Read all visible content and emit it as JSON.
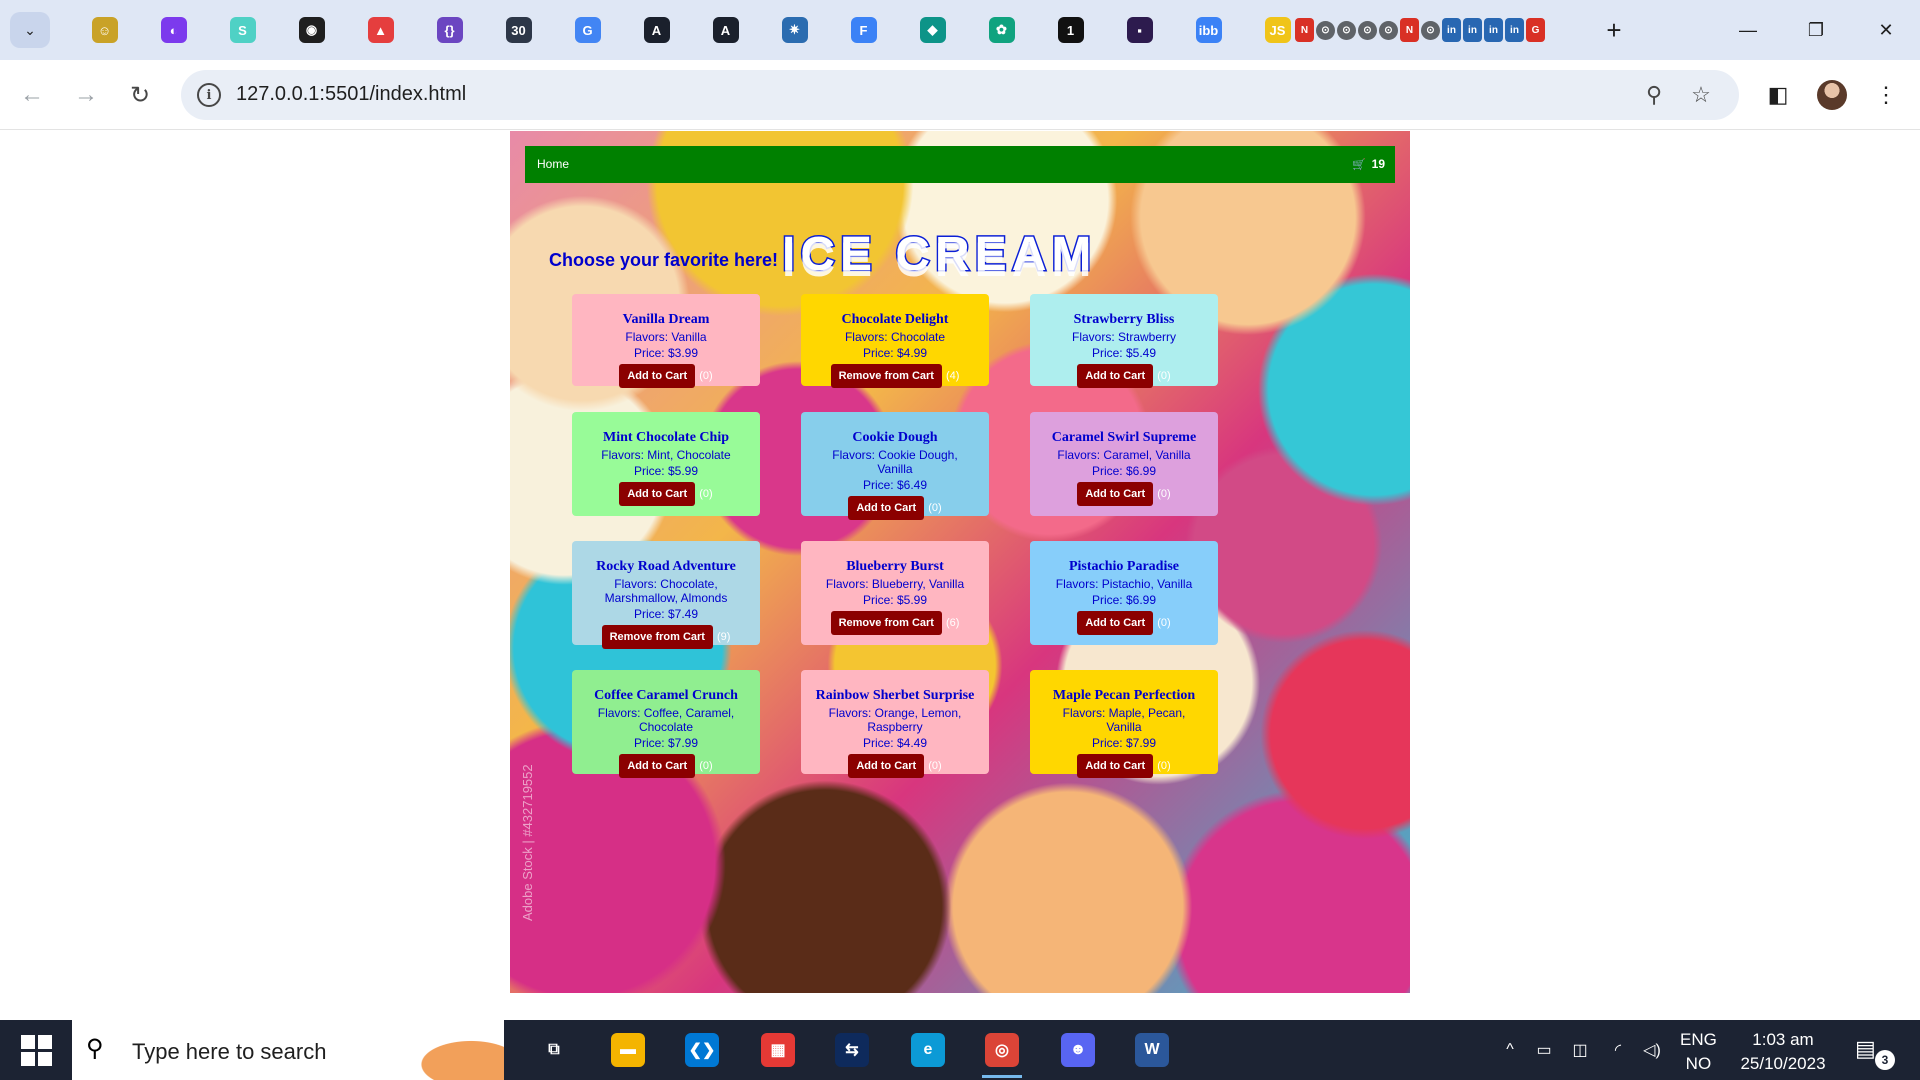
{
  "browser": {
    "tab_icons": [
      {
        "name": "chatbot-tab-icon",
        "glyph": "☺",
        "color": "#c9a227"
      },
      {
        "name": "arc-tab-icon",
        "glyph": "◐",
        "color": "#7c3aed"
      },
      {
        "name": "s-tab-icon",
        "glyph": "S",
        "color": "#4fd1c5"
      },
      {
        "name": "github-tab-icon",
        "glyph": "◉",
        "color": "#1f1f1f"
      },
      {
        "name": "warning-tab-icon",
        "glyph": "▲",
        "color": "#e53e3e"
      },
      {
        "name": "code-tab-icon",
        "glyph": "{}",
        "color": "#6b46c1"
      },
      {
        "name": "thirty-tab-icon",
        "glyph": "30",
        "color": "#2d3748"
      },
      {
        "name": "google-tab-icon",
        "glyph": "G",
        "color": "#4285f4"
      },
      {
        "name": "regex-tab-icon",
        "glyph": "A",
        "color": "#1a202c"
      },
      {
        "name": "regex2-tab-icon",
        "glyph": "A",
        "color": "#1a202c"
      },
      {
        "name": "fan-tab-icon",
        "glyph": "✷",
        "color": "#2b6cb0"
      },
      {
        "name": "forms-tab-icon",
        "glyph": "F",
        "color": "#3b82f6"
      },
      {
        "name": "diamond-tab-icon",
        "glyph": "◆",
        "color": "#0d9488"
      },
      {
        "name": "openai-tab-icon",
        "glyph": "✿",
        "color": "#10a37f"
      },
      {
        "name": "one-tab-icon",
        "glyph": "1",
        "color": "#111111"
      },
      {
        "name": "terminal-tab-icon",
        "glyph": "▪",
        "color": "#2d1b4e"
      },
      {
        "name": "ibb-tab-icon",
        "glyph": "ibb",
        "color": "#3b82f6"
      },
      {
        "name": "js-tab-icon",
        "glyph": "JS",
        "color": "#f0c419"
      }
    ],
    "tab_cluster": [
      "N",
      "⊙",
      "⊙",
      "⊙",
      "⊙",
      "N",
      "⊙",
      "in",
      "in",
      "in",
      "in",
      "G"
    ],
    "new_tab": "+",
    "window": {
      "minimize": "—",
      "restore": "❐",
      "close": "✕"
    },
    "nav": {
      "back": "←",
      "forward": "→",
      "reload": "↻"
    },
    "url": "127.0.0.1:5501/index.html",
    "omni_actions": {
      "zoom": "⚲",
      "bookmark": "☆"
    },
    "sidebar_toggle": "◧",
    "menu": "⋮"
  },
  "site": {
    "nav_home": "Home",
    "cart_count": "19",
    "tagline": "Choose your favorite here!",
    "brand": "ICE CREAM",
    "watermark": "Adobe Stock | #432719552"
  },
  "products": [
    {
      "name": "Vanilla Dream",
      "flavors": "Flavors: Vanilla",
      "price": "Price: $3.99",
      "button": "Add to Cart",
      "count": "(0)",
      "bg": "#ffb6c1"
    },
    {
      "name": "Chocolate Delight",
      "flavors": "Flavors: Chocolate",
      "price": "Price: $4.99",
      "button": "Remove from Cart",
      "count": "(4)",
      "bg": "#ffd700"
    },
    {
      "name": "Strawberry Bliss",
      "flavors": "Flavors: Strawberry",
      "price": "Price: $5.49",
      "button": "Add to Cart",
      "count": "(0)",
      "bg": "#aeeeee"
    },
    {
      "name": "Mint Chocolate Chip",
      "flavors": "Flavors: Mint, Chocolate",
      "price": "Price: $5.99",
      "button": "Add to Cart",
      "count": "(0)",
      "bg": "#98fb98"
    },
    {
      "name": "Cookie Dough",
      "flavors": "Flavors: Cookie Dough, Vanilla",
      "price": "Price: $6.49",
      "button": "Add to Cart",
      "count": "(0)",
      "bg": "#87ceeb"
    },
    {
      "name": "Caramel Swirl Supreme",
      "flavors": "Flavors: Caramel, Vanilla",
      "price": "Price: $6.99",
      "button": "Add to Cart",
      "count": "(0)",
      "bg": "#dda0dd"
    },
    {
      "name": "Rocky Road Adventure",
      "flavors": "Flavors: Chocolate, Marshmallow, Almonds",
      "price": "Price: $7.49",
      "button": "Remove from Cart",
      "count": "(9)",
      "bg": "#add8e6"
    },
    {
      "name": "Blueberry Burst",
      "flavors": "Flavors: Blueberry, Vanilla",
      "price": "Price: $5.99",
      "button": "Remove from Cart",
      "count": "(6)",
      "bg": "#ffb6c1"
    },
    {
      "name": "Pistachio Paradise",
      "flavors": "Flavors: Pistachio, Vanilla",
      "price": "Price: $6.99",
      "button": "Add to Cart",
      "count": "(0)",
      "bg": "#87cefa"
    },
    {
      "name": "Coffee Caramel Crunch",
      "flavors": "Flavors: Coffee, Caramel, Chocolate",
      "price": "Price: $7.99",
      "button": "Add to Cart",
      "count": "(0)",
      "bg": "#90ee90"
    },
    {
      "name": "Rainbow Sherbet Surprise",
      "flavors": "Flavors: Orange, Lemon, Raspberry",
      "price": "Price: $4.49",
      "button": "Add to Cart",
      "count": "(0)",
      "bg": "#ffb6c1"
    },
    {
      "name": "Maple Pecan Perfection",
      "flavors": "Flavors: Maple, Pecan, Vanilla",
      "price": "Price: $7.99",
      "button": "Add to Cart",
      "count": "(0)",
      "bg": "#ffd700"
    }
  ],
  "taskbar": {
    "search_placeholder": "Type here to search",
    "apps": [
      {
        "name": "task-view-icon",
        "glyph": "⧉",
        "color": "transparent"
      },
      {
        "name": "file-explorer-icon",
        "glyph": "▬",
        "color": "#f4b400"
      },
      {
        "name": "vscode-icon",
        "glyph": "❮❯",
        "color": "#0078d4"
      },
      {
        "name": "ms-store-icon",
        "glyph": "▦",
        "color": "#e53935"
      },
      {
        "name": "teamviewer-icon",
        "glyph": "⇆",
        "color": "#0e2a5c"
      },
      {
        "name": "edge-icon",
        "glyph": "e",
        "color": "#0c9ad6"
      },
      {
        "name": "chrome-icon",
        "glyph": "◎",
        "color": "#db4437"
      },
      {
        "name": "discord-icon",
        "glyph": "☻",
        "color": "#5865f2"
      },
      {
        "name": "word-icon",
        "glyph": "W",
        "color": "#2b579a"
      }
    ],
    "tray": {
      "chevron": "^",
      "battery": "▭",
      "meet": "◫",
      "wifi": "◜",
      "volume": "◁)"
    },
    "lang_1": "ENG",
    "lang_2": "NO",
    "time": "1:03 am",
    "date": "25/10/2023",
    "notification_count": "3",
    "notification_icon": "▤"
  }
}
